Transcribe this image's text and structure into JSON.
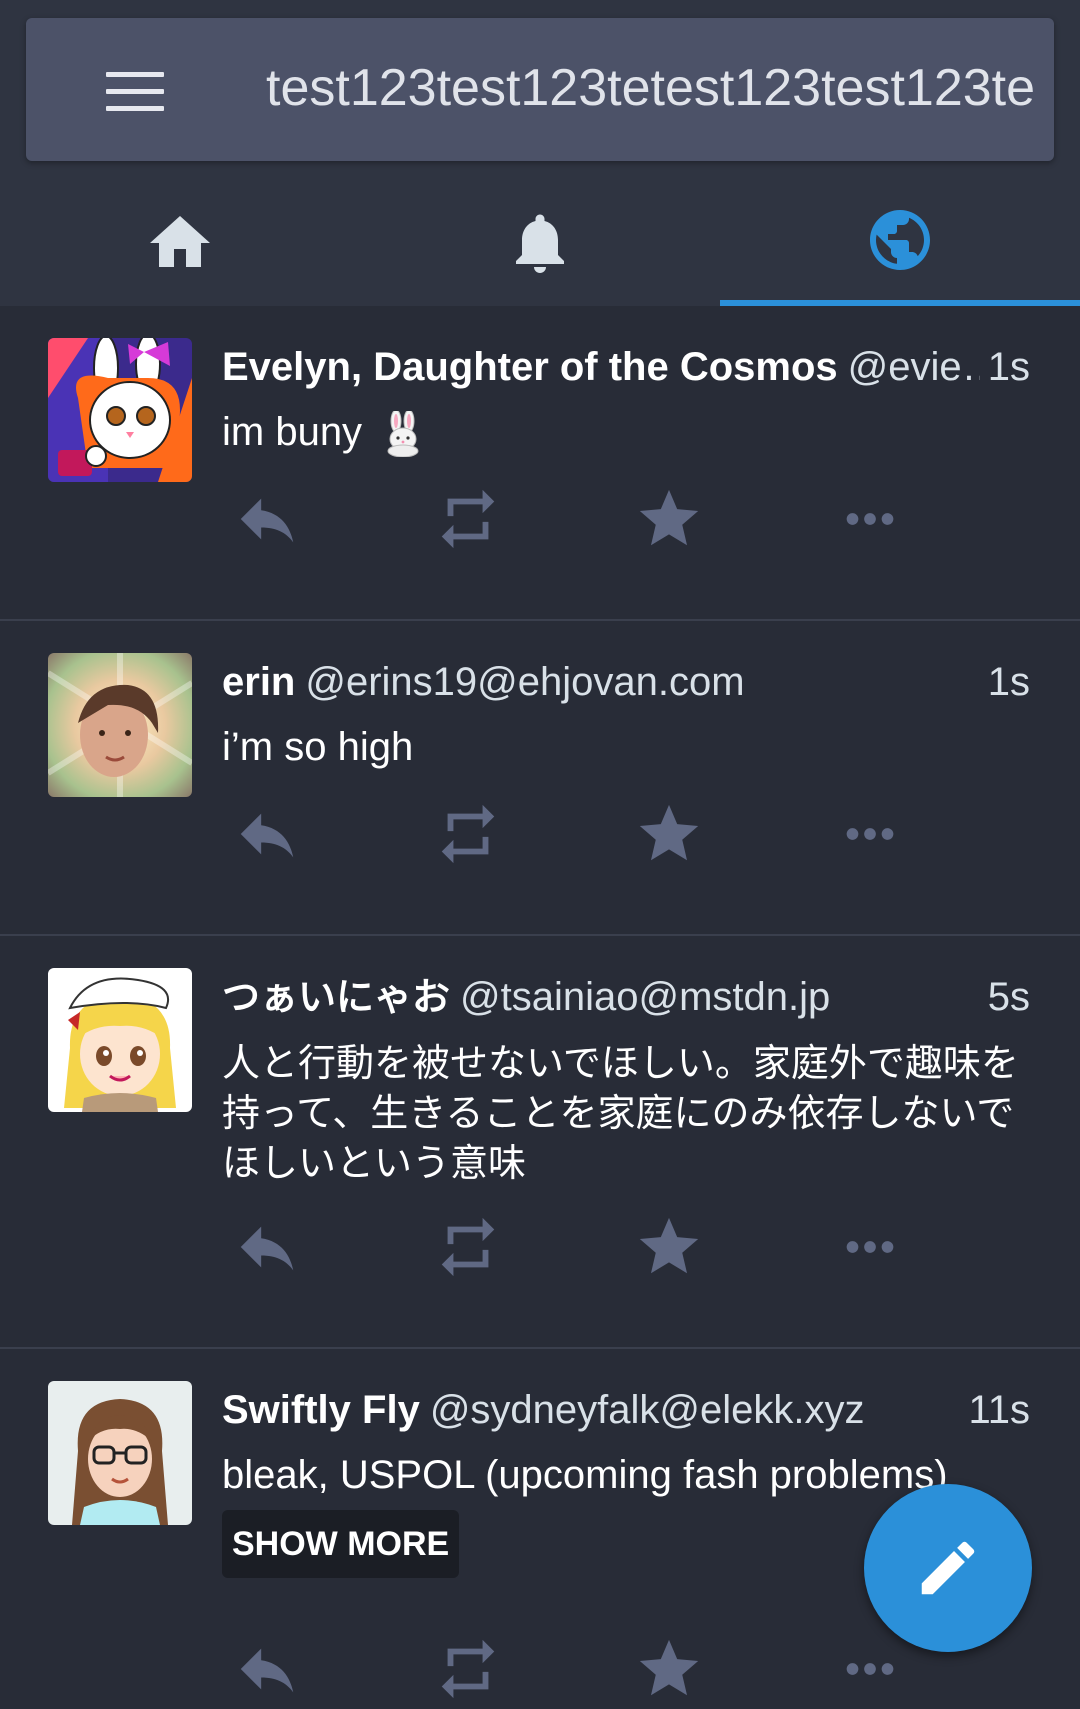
{
  "search": {
    "query": "test123test123tetest123test123te"
  },
  "tabs": [
    {
      "name": "home",
      "icon": "home-icon",
      "active": false
    },
    {
      "name": "notifications",
      "icon": "bell-icon",
      "active": false
    },
    {
      "name": "federated",
      "icon": "globe-icon",
      "active": true
    }
  ],
  "colors": {
    "accent": "#2b90d9",
    "background": "#282c37",
    "icon_muted": "#606984"
  },
  "posts": [
    {
      "display_name": "Evelyn, Daughter of the Cosmos",
      "acct": "@evie…",
      "time": "1s",
      "content": "im buny",
      "emoji": "rabbit-emoji"
    },
    {
      "display_name": "erin",
      "acct": "@erins19@ehjovan.com",
      "time": "1s",
      "content": "i’m so high"
    },
    {
      "display_name": "つぁいにゃお",
      "acct": "@tsainiao@mstdn.jp",
      "time": "5s",
      "content": "人と行動を被せないでほしい。家庭外で趣味を持って、生きることを家庭にのみ依存しないでほしいという意味"
    },
    {
      "display_name": "Swiftly Fly",
      "acct": "@sydneyfalk@elekk.xyz",
      "time": "11s",
      "content": "bleak, USPOL (upcoming fash problems)",
      "show_more_label": "SHOW MORE"
    }
  ]
}
